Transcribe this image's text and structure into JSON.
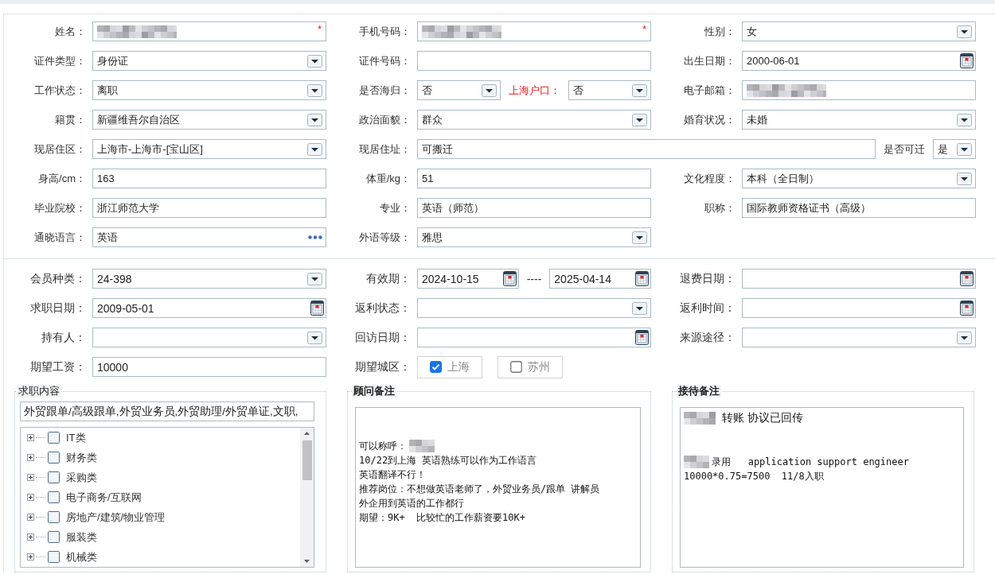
{
  "sections": [
    {
      "fields": [
        {
          "label": "姓名：",
          "controls": [
            {
              "kind": "text",
              "redacted": true,
              "required_mark": "*"
            }
          ]
        },
        {
          "label": "手机号码：",
          "controls": [
            {
              "kind": "text",
              "redacted": true,
              "required_mark": "*"
            }
          ]
        },
        {
          "label": "性别：",
          "controls": [
            {
              "kind": "select",
              "value": "女"
            }
          ]
        },
        {
          "label": "证件类型：",
          "controls": [
            {
              "kind": "select",
              "value": "身份证"
            }
          ]
        },
        {
          "label": "证件号码：",
          "controls": [
            {
              "kind": "text"
            }
          ]
        },
        {
          "label": "出生日期：",
          "controls": [
            {
              "kind": "date",
              "value": "2000-06-01"
            }
          ]
        },
        {
          "label": "工作状态：",
          "controls": [
            {
              "kind": "select",
              "value": "离职"
            }
          ]
        },
        {
          "label": "是否海归：",
          "controls": [
            {
              "kind": "select",
              "value": "否"
            },
            {
              "kind": "label",
              "text": "上海户口：",
              "highlighted": true
            },
            {
              "kind": "select",
              "value": "否"
            }
          ]
        },
        {
          "label": "电子邮箱：",
          "controls": [
            {
              "kind": "text",
              "redacted": true
            }
          ]
        },
        {
          "label": "籍贯：",
          "controls": [
            {
              "kind": "select",
              "value": "新疆维吾尔自治区"
            }
          ]
        },
        {
          "label": "政治面貌：",
          "controls": [
            {
              "kind": "select",
              "value": "群众"
            }
          ]
        },
        {
          "label": "婚育状况：",
          "controls": [
            {
              "kind": "select",
              "value": "未婚"
            }
          ]
        },
        {
          "label": "现居住区：",
          "controls": [
            {
              "kind": "select",
              "value": "上海市-上海市-[宝山区]"
            }
          ]
        },
        {
          "label": "现居住址：",
          "wide": true,
          "controls": [
            {
              "kind": "text",
              "value": "可搬迁"
            },
            {
              "kind": "label",
              "text": "是否可迁",
              "highlighted": false
            },
            {
              "kind": "select",
              "value": "是"
            }
          ]
        },
        {
          "label": "身高/cm：",
          "controls": [
            {
              "kind": "text",
              "value": "163"
            }
          ]
        },
        {
          "label": "体重/kg：",
          "controls": [
            {
              "kind": "text",
              "value": "51"
            }
          ]
        },
        {
          "label": "文化程度：",
          "controls": [
            {
              "kind": "select",
              "value": "本科（全日制）"
            }
          ]
        },
        {
          "label": "毕业院校：",
          "controls": [
            {
              "kind": "text",
              "value": "浙江师范大学"
            }
          ]
        },
        {
          "label": "专业：",
          "controls": [
            {
              "kind": "text",
              "value": "英语（师范）"
            }
          ]
        },
        {
          "label": "职称：",
          "controls": [
            {
              "kind": "text",
              "value": "国际教师资格证书（高级）"
            }
          ]
        },
        {
          "label": "通晓语言：",
          "controls": [
            {
              "kind": "lookup",
              "value": "英语"
            }
          ]
        },
        {
          "label": "外语等级：",
          "controls": [
            {
              "kind": "select",
              "value": "雅思"
            }
          ]
        }
      ]
    },
    {
      "fields": [
        {
          "label": "会员种类：",
          "controls": [
            {
              "kind": "select",
              "value": "24-398"
            }
          ]
        },
        {
          "label": "有效期：",
          "controls": [
            {
              "kind": "date",
              "value": "2024-10-15"
            },
            {
              "kind": "label",
              "text": "----",
              "highlighted": false
            },
            {
              "kind": "date",
              "value": "2025-04-14"
            }
          ]
        },
        {
          "label": "退费日期：",
          "controls": [
            {
              "kind": "date"
            }
          ]
        },
        {
          "label": "求职日期：",
          "controls": [
            {
              "kind": "date",
              "value": "2009-05-01"
            }
          ]
        },
        {
          "label": "返利状态：",
          "controls": [
            {
              "kind": "select"
            }
          ]
        },
        {
          "label": "返利时间：",
          "controls": [
            {
              "kind": "date"
            }
          ]
        },
        {
          "label": "持有人：",
          "controls": [
            {
              "kind": "select"
            }
          ]
        },
        {
          "label": "回访日期：",
          "controls": [
            {
              "kind": "date"
            }
          ]
        },
        {
          "label": "来源途径：",
          "controls": [
            {
              "kind": "select"
            }
          ]
        },
        {
          "label": "期望工资：",
          "controls": [
            {
              "kind": "text",
              "value": "10000"
            }
          ]
        },
        {
          "label": "期望城区：",
          "controls": [
            {
              "kind": "checkbox",
              "text": "上海",
              "checked": true
            },
            {
              "kind": "checkbox",
              "text": "苏州",
              "checked": false
            }
          ]
        }
      ]
    }
  ],
  "panels": [
    {
      "kind": "tree",
      "legend": "求职内容",
      "summary": "外贸跟单/高级跟单,外贸业务员,外贸助理/外贸单证,文职,",
      "items": [
        {
          "label": "IT类",
          "expanded": false,
          "checked": false
        },
        {
          "label": "财务类",
          "expanded": false,
          "checked": false
        },
        {
          "label": "采购类",
          "expanded": false,
          "checked": false
        },
        {
          "label": "电子商务/互联网",
          "expanded": false,
          "checked": false
        },
        {
          "label": "房地产/建筑/物业管理",
          "expanded": false,
          "checked": false
        },
        {
          "label": "服装类",
          "expanded": false,
          "checked": false
        },
        {
          "label": "机械类",
          "expanded": false,
          "checked": false
        }
      ]
    },
    {
      "kind": "note",
      "legend": "顾问备注",
      "lines": [
        {
          "kind": "gap"
        },
        {
          "kind": "gap"
        },
        {
          "kind": "plain",
          "parts": [
            {
              "kind": "text",
              "text": "可以称呼："
            },
            {
              "kind": "redacted"
            }
          ]
        },
        {
          "kind": "plain",
          "parts": [
            {
              "kind": "text",
              "text": "10/22到上海 英语熟练可以作为工作语言"
            }
          ]
        },
        {
          "kind": "plain",
          "parts": [
            {
              "kind": "text",
              "text": "英语翻译不行！"
            }
          ]
        },
        {
          "kind": "plain",
          "parts": [
            {
              "kind": "text",
              "text": "推荐岗位：不想做英语老师了，外贸业务员/跟单 讲解员"
            }
          ]
        },
        {
          "kind": "plain",
          "parts": [
            {
              "kind": "text",
              "text": "外企用到英语的工作都行"
            }
          ]
        },
        {
          "kind": "plain",
          "parts": [
            {
              "kind": "text",
              "text": "期望：9K+  比较忙的工作薪资要10K+"
            }
          ]
        }
      ]
    },
    {
      "kind": "note",
      "legend": "接待备注",
      "lines": [
        {
          "kind": "large",
          "parts": [
            {
              "kind": "redacted"
            },
            {
              "kind": "text",
              "text": "转账 协议已回传"
            }
          ]
        },
        {
          "kind": "gap"
        },
        {
          "kind": "gap"
        },
        {
          "kind": "plain",
          "parts": [
            {
              "kind": "redacted"
            },
            {
              "kind": "text",
              "text": "录用   application support engineer"
            }
          ]
        },
        {
          "kind": "plain",
          "parts": [
            {
              "kind": "text",
              "text": "10000*0.75=7500  11/8入职"
            }
          ]
        }
      ]
    }
  ]
}
